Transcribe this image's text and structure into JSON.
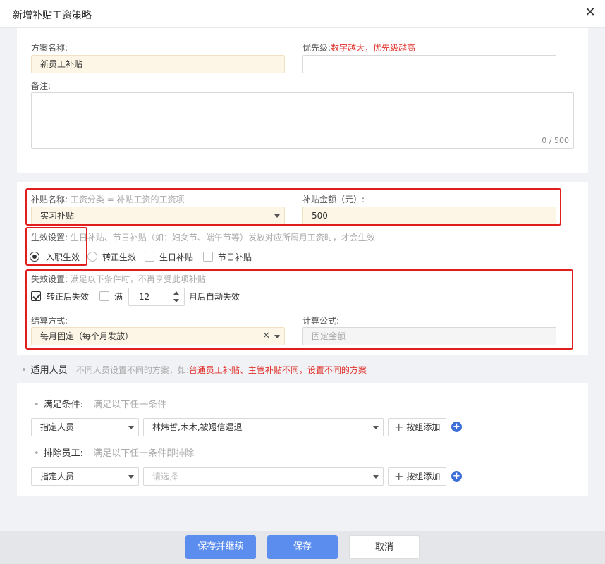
{
  "dialog": {
    "title": "新增补贴工资策略",
    "close_icon": "✕"
  },
  "basic": {
    "plan_name_label": "方案名称:",
    "plan_name_value": "新员工补贴",
    "priority_label": "优先级:",
    "priority_hint": "数字越大，优先级越高",
    "priority_value": "",
    "remark_label": "备注:",
    "remark_counter": "0 / 500"
  },
  "subsidy": {
    "name_label": "补贴名称:",
    "name_hint": "工资分类 = 补贴工资的工资项",
    "name_value": "实习补贴",
    "amount_label": "补贴金额（元）:",
    "amount_value": "500",
    "effective_label": "生效设置:",
    "effective_hint": "生日补贴、节日补贴（如：妇女节、端午节等）发放对应所属月工资时，才会生效",
    "effective_options": [
      {
        "label": "入职生效",
        "checked": true
      },
      {
        "label": "转正生效",
        "checked": false
      },
      {
        "label": "生日补贴",
        "checked": false
      },
      {
        "label": "节日补贴",
        "checked": false
      }
    ],
    "expire_label": "失效设置:",
    "expire_hint": "满足以下条件时，不再享受此项补贴",
    "expire_after_regular": "转正后失效",
    "expire_full_label": "满",
    "expire_months": "12",
    "expire_suffix": "月后自动失效",
    "settle_label": "结算方式:",
    "settle_value": "每月固定（每个月发放）",
    "formula_label": "计算公式:",
    "formula_value": "固定金额"
  },
  "applicable": {
    "title": "适用人员",
    "hint": "不同人员设置不同的方案，如:",
    "hint_red": "普通员工补贴、主管补贴不同，设置不同的方案",
    "meet_label": "满足条件:",
    "meet_hint": "满足以下任一条件",
    "meet_type": "指定人员",
    "meet_people": "林炜晢,木木,被短信逼退",
    "exclude_label": "排除员工:",
    "exclude_hint": "满足以下任一条件即排除",
    "exclude_type": "指定人员",
    "exclude_placeholder": "请选择",
    "group_add": "按组添加"
  },
  "footer": {
    "save_continue": "保存并继续",
    "save": "保存",
    "cancel": "取消"
  },
  "colors": {
    "primary": "#5b8def",
    "highlight_box": "#e11d1d",
    "warning_text": "#e0312b",
    "filled_bg": "#fdf6e7"
  }
}
